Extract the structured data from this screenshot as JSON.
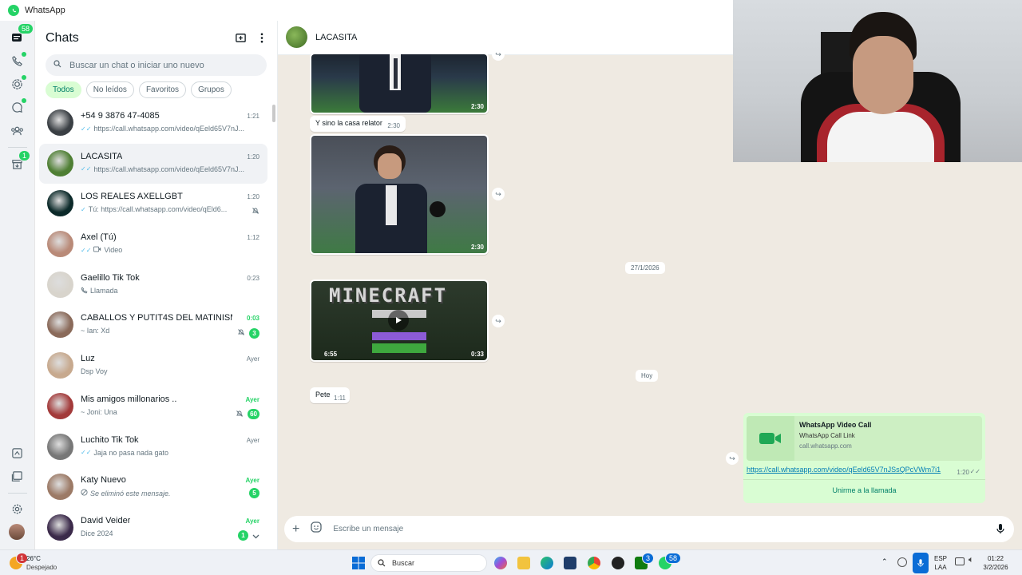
{
  "window": {
    "title": "WhatsApp"
  },
  "rail": {
    "chats_badge": "58",
    "archive_badge": "1",
    "icons": [
      "chats-icon",
      "calls-icon",
      "status-icon",
      "channels-icon",
      "communities-icon",
      "archive-icon",
      "starred-icon",
      "media-icon",
      "settings-icon",
      "profile-avatar"
    ]
  },
  "sidebar": {
    "title": "Chats",
    "search_placeholder": "Buscar un chat o iniciar uno nuevo",
    "filters": [
      {
        "label": "Todos",
        "active": true
      },
      {
        "label": "No leídos",
        "active": false
      },
      {
        "label": "Favoritos",
        "active": false
      },
      {
        "label": "Grupos",
        "active": false
      }
    ],
    "chats": [
      {
        "name": "+54 9 3876 47-4085",
        "time": "1:21",
        "preview": "https://call.whatsapp.com/video/qEeld65V7nJ...",
        "ticks": "✓✓",
        "avatar_color": "#3a3f44",
        "selected": false
      },
      {
        "name": "LACASITA",
        "time": "1:20",
        "preview": "https://call.whatsapp.com/video/qEeld65V7nJ...",
        "ticks": "✓✓",
        "avatar_color": "#4f7f34",
        "selected": true
      },
      {
        "name": "LOS REALES AXELLGBT",
        "time": "1:20",
        "preview": "Tú: https://call.whatsapp.com/video/qEld6...",
        "ticks": "✓",
        "avatar_color": "#0c2a2a",
        "muted": true
      },
      {
        "name": "Axel (Tú)",
        "time": "1:12",
        "preview": "Video",
        "ticks": "✓✓",
        "video": true,
        "avatar_color": "#b98a78"
      },
      {
        "name": "Gaelillo Tik Tok",
        "time": "0:23",
        "preview": "Llamada",
        "call": true,
        "avatar_color": "#d8d4cc"
      },
      {
        "name": "CABALLOS Y PUTIT4S DEL MATINISMO",
        "time": "0:03",
        "time_green": true,
        "preview": "~ Ian: Xd",
        "muted": true,
        "count": "3",
        "avatar_color": "#8a6a5a"
      },
      {
        "name": "Luz",
        "time": "Ayer",
        "preview": "Dsp Voy",
        "avatar_color": "#c7a98e"
      },
      {
        "name": "Mis amigos millonarios ..",
        "time": "Ayer",
        "time_green": true,
        "preview": "~ Joni: Una",
        "muted": true,
        "count": "60",
        "avatar_color": "#a33a3a"
      },
      {
        "name": "Luchito Tik Tok",
        "time": "Ayer",
        "preview": "Jaja no pasa nada gato",
        "ticks": "✓✓",
        "avatar_color": "#777"
      },
      {
        "name": "Katy Nuevo",
        "time": "Ayer",
        "time_green": true,
        "preview": "Se eliminó este mensaje.",
        "deleted": true,
        "count": "5",
        "avatar_color": "#9c7a66"
      },
      {
        "name": "David Veider",
        "time": "Ayer",
        "time_green": true,
        "preview": "Dice 2024",
        "count": "1",
        "chevron": true,
        "avatar_color": "#3b2a4a"
      }
    ]
  },
  "chat": {
    "name": "LACASITA",
    "messages": {
      "video1_duration": "2:30",
      "text1": "Y sino la casa relator",
      "text1_time": "2:30",
      "video2_duration": "2:30",
      "date1": "27/1/2026",
      "video3_duration": "0:33",
      "video3_inner": "6:55",
      "video3_title": "MINECRAFT",
      "date2": "Hoy",
      "text2": "Pete",
      "text2_time": "1:11",
      "link_title": "WhatsApp Video Call",
      "link_subtitle": "WhatsApp Call Link",
      "link_domain": "call.whatsapp.com",
      "link_url": "https://call.whatsapp.com/video/qEeld65V7nJSsQPcVWm7i1",
      "link_time": "1:20",
      "link_ticks": "✓✓",
      "join_label": "Unirme a la llamada"
    },
    "composer_placeholder": "Escribe un mensaje"
  },
  "taskbar": {
    "weather_temp": "26°C",
    "weather_desc": "Despejado",
    "weather_badge": "1",
    "search": "Buscar",
    "lang1": "ESP",
    "lang2": "LAA",
    "time": "01:22",
    "date": "3/2/2026",
    "xbox_badge": "3",
    "whatsapp_badge": "58"
  }
}
